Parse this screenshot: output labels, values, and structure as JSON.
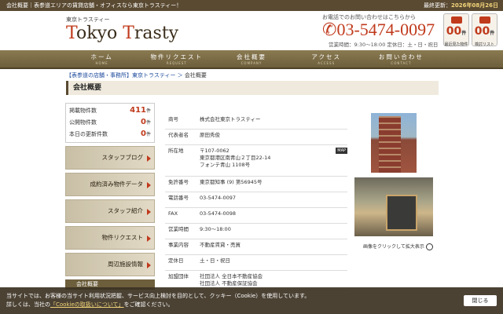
{
  "topbar": {
    "title": "会社概要｜表参道エリアの賃貸店舗・オフィスなら東京トラスティー！",
    "updated_label": "最終更新：",
    "updated_date": "2026年08月26日"
  },
  "header": {
    "logo_sub": "東京トラスティー",
    "logo_a": "T",
    "logo_b": "okyo ",
    "logo_c": "T",
    "logo_d": "rasty",
    "tel_label": "お電話でのお問い合わせはこちらから",
    "tel": "03-5474-0097",
    "hours": "営業時間：9:30〜18:00 定休日：土・日・祝日",
    "recent": {
      "count": "00",
      "unit": "件",
      "label": "最近見た物件"
    },
    "review": {
      "count": "00",
      "unit": "件",
      "label": "検討リスト"
    }
  },
  "nav": [
    {
      "label": "ホーム",
      "en": "HOME"
    },
    {
      "label": "物件リクエスト",
      "en": "REQUEST"
    },
    {
      "label": "会社概要",
      "en": "COMPANY"
    },
    {
      "label": "アクセス",
      "en": "ACCESS"
    },
    {
      "label": "お問い合わせ",
      "en": "CONTACT"
    }
  ],
  "crumb": {
    "link": "【表参道の店舗・事務所】東京トラスティー",
    "sep": " ＞ ",
    "current": "会社概要"
  },
  "page_title": "会社概要",
  "stats": [
    {
      "label": "掲載物件数",
      "value": "411",
      "unit": "件"
    },
    {
      "label": "公開物件数",
      "value": "0",
      "unit": "件"
    },
    {
      "label": "本日の更新件数",
      "value": "0",
      "unit": "件"
    }
  ],
  "side_buttons": [
    "スタッフブログ",
    "成約済み物件データ",
    "スタッフ紹介",
    "物件リクエスト",
    "周辺施設情報"
  ],
  "side_title": "会社概要",
  "company": {
    "name_k": "商号",
    "name_v": "株式会社東京トラスティー",
    "rep_k": "代表者名",
    "rep_v": "原田秀俊",
    "addr_k": "所在地",
    "addr_v1": "〒107-0062",
    "addr_v2": "東京都港区南青山２丁目22-14",
    "addr_v3": "フォンテ青山 1108号",
    "map_label": "MAP",
    "lic_k": "免許番号",
    "lic_v": "東京都知事 (9) 第56945号",
    "tel_k": "電話番号",
    "tel_v": "03-5474-0097",
    "fax_k": "FAX",
    "fax_v": "03-5474-0098",
    "hours_k": "営業時間",
    "hours_v": "9:30〜18:00",
    "biz_k": "事業内容",
    "biz_v": "不動産賃貸・売買",
    "holiday_k": "定休日",
    "holiday_v": "土・日・祝日",
    "org_k": "加盟団体",
    "org_v1": "社団法人 全日本不動産協会",
    "org_v2": "社団法人 不動産保証協会"
  },
  "photo_caption": "画像をクリックして拡大表示",
  "cookie": {
    "line1": "当サイトでは、お客様の当サイト利用状況把握、サービス向上検討を目的として、クッキー（Cookie）を使用しています。",
    "line2a": "詳しくは、当社の",
    "link": "「Cookieの取扱いについて」",
    "line2b": "をご確認ください。",
    "close": "閉じる"
  }
}
